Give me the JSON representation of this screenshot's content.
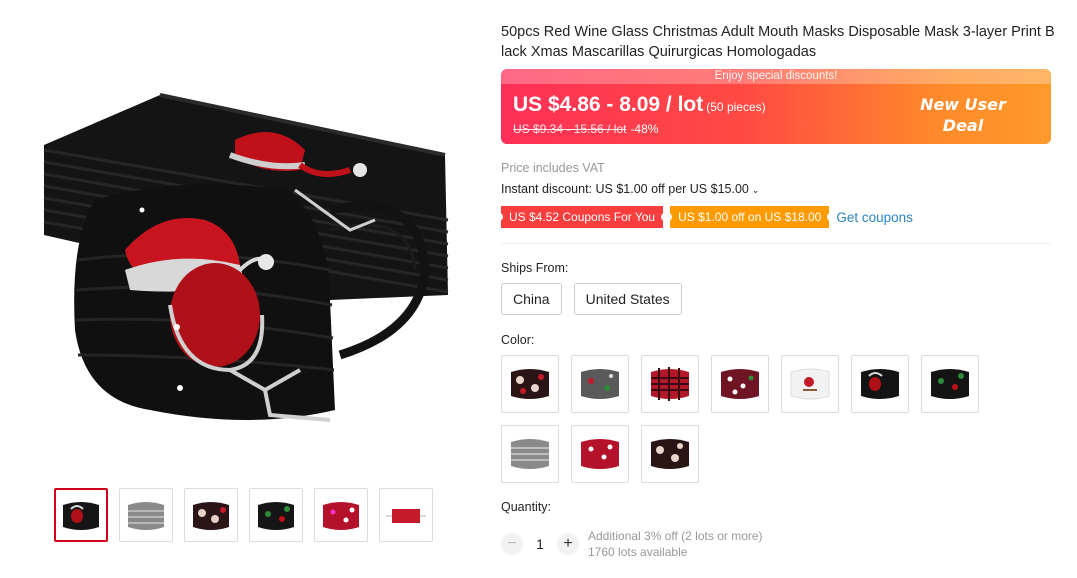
{
  "product": {
    "title": "50pcs Red Wine Glass Christmas Adult Mouth Masks Disposable Mask 3-layer Print Black Xmas Mascarillas Quirurgicas Homologadas"
  },
  "price": {
    "banner_top": "Enjoy special discounts!",
    "current": "US $4.86 - 8.09 / lot",
    "unit": "(50 pieces)",
    "original": "US $9.34 - 15.56 / lot",
    "discount": "-48%",
    "deal_line1": "New User",
    "deal_line2": "Deal"
  },
  "vat": "Price includes VAT",
  "instant_discount": "Instant discount: US $1.00 off per US $15.00",
  "coupons": {
    "red": "US $4.52 Coupons For You",
    "orange": "US $1.00 off on US $18.00",
    "link": "Get coupons"
  },
  "ships": {
    "label": "Ships From:",
    "options": [
      "China",
      "United States"
    ]
  },
  "color": {
    "label": "Color:"
  },
  "quantity": {
    "label": "Quantity:",
    "value": "1",
    "minus": "−",
    "plus": "+",
    "info1": "Additional 3% off (2 lots or more)",
    "info2": "1760 lots available"
  },
  "colors": {
    "brand_red": "#d0021b",
    "banner_start": "#ff2f57",
    "banner_end": "#ff9a2b",
    "coupon_red": "#fa3e3e",
    "coupon_orange": "#ff9a00",
    "link_blue": "#2e86c1"
  }
}
